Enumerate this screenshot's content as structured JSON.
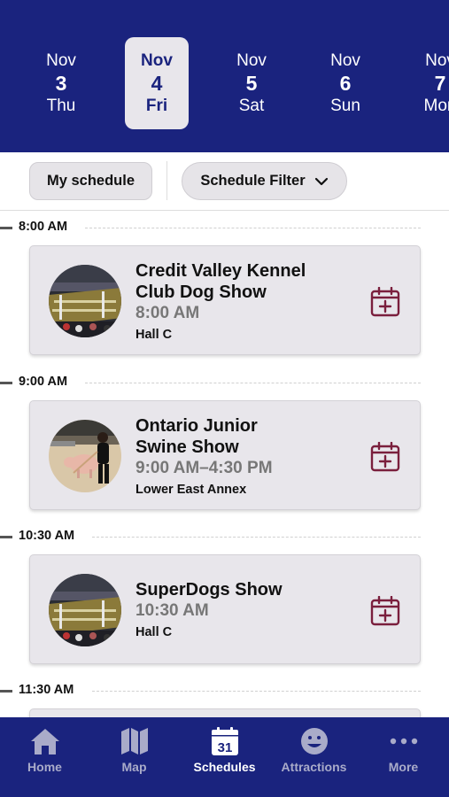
{
  "dates": [
    {
      "month": "Nov",
      "day": "3",
      "dow": "Thu",
      "selected": false
    },
    {
      "month": "Nov",
      "day": "4",
      "dow": "Fri",
      "selected": true
    },
    {
      "month": "Nov",
      "day": "5",
      "dow": "Sat",
      "selected": false
    },
    {
      "month": "Nov",
      "day": "6",
      "dow": "Sun",
      "selected": false
    },
    {
      "month": "Nov",
      "day": "7",
      "dow": "Mon",
      "selected": false
    }
  ],
  "filters": {
    "my_schedule_label": "My schedule",
    "schedule_filter_label": "Schedule Filter"
  },
  "timeslots": [
    {
      "time": "8:00 AM",
      "event": {
        "title_line1": "Credit Valley Kennel",
        "title_line2": "Club Dog Show",
        "time": "8:00 AM",
        "location": "Hall C",
        "image": "dog-show-arena"
      }
    },
    {
      "time": "9:00 AM",
      "event": {
        "title_line1": "Ontario Junior",
        "title_line2": "Swine Show",
        "time": "9:00 AM–4:30 PM",
        "location": "Lower East Annex",
        "image": "swine-show"
      }
    },
    {
      "time": "10:30 AM",
      "event": {
        "title_line1": "SuperDogs Show",
        "title_line2": "",
        "time": "10:30 AM",
        "location": "Hall C",
        "image": "dog-show-arena"
      }
    },
    {
      "time": "11:30 AM",
      "event": null
    }
  ],
  "nav": {
    "items": [
      {
        "label": "Home",
        "icon": "home-icon",
        "active": false
      },
      {
        "label": "Map",
        "icon": "map-icon",
        "active": false
      },
      {
        "label": "Schedules",
        "icon": "calendar-icon",
        "active": true,
        "icon_text": "31"
      },
      {
        "label": "Attractions",
        "icon": "smiley-icon",
        "active": false
      },
      {
        "label": "More",
        "icon": "more-icon",
        "active": false
      }
    ]
  },
  "colors": {
    "brand_navy": "#1a237e",
    "card_bg": "#e8e6eb",
    "calendar_add_accent": "#7a1f3d"
  }
}
